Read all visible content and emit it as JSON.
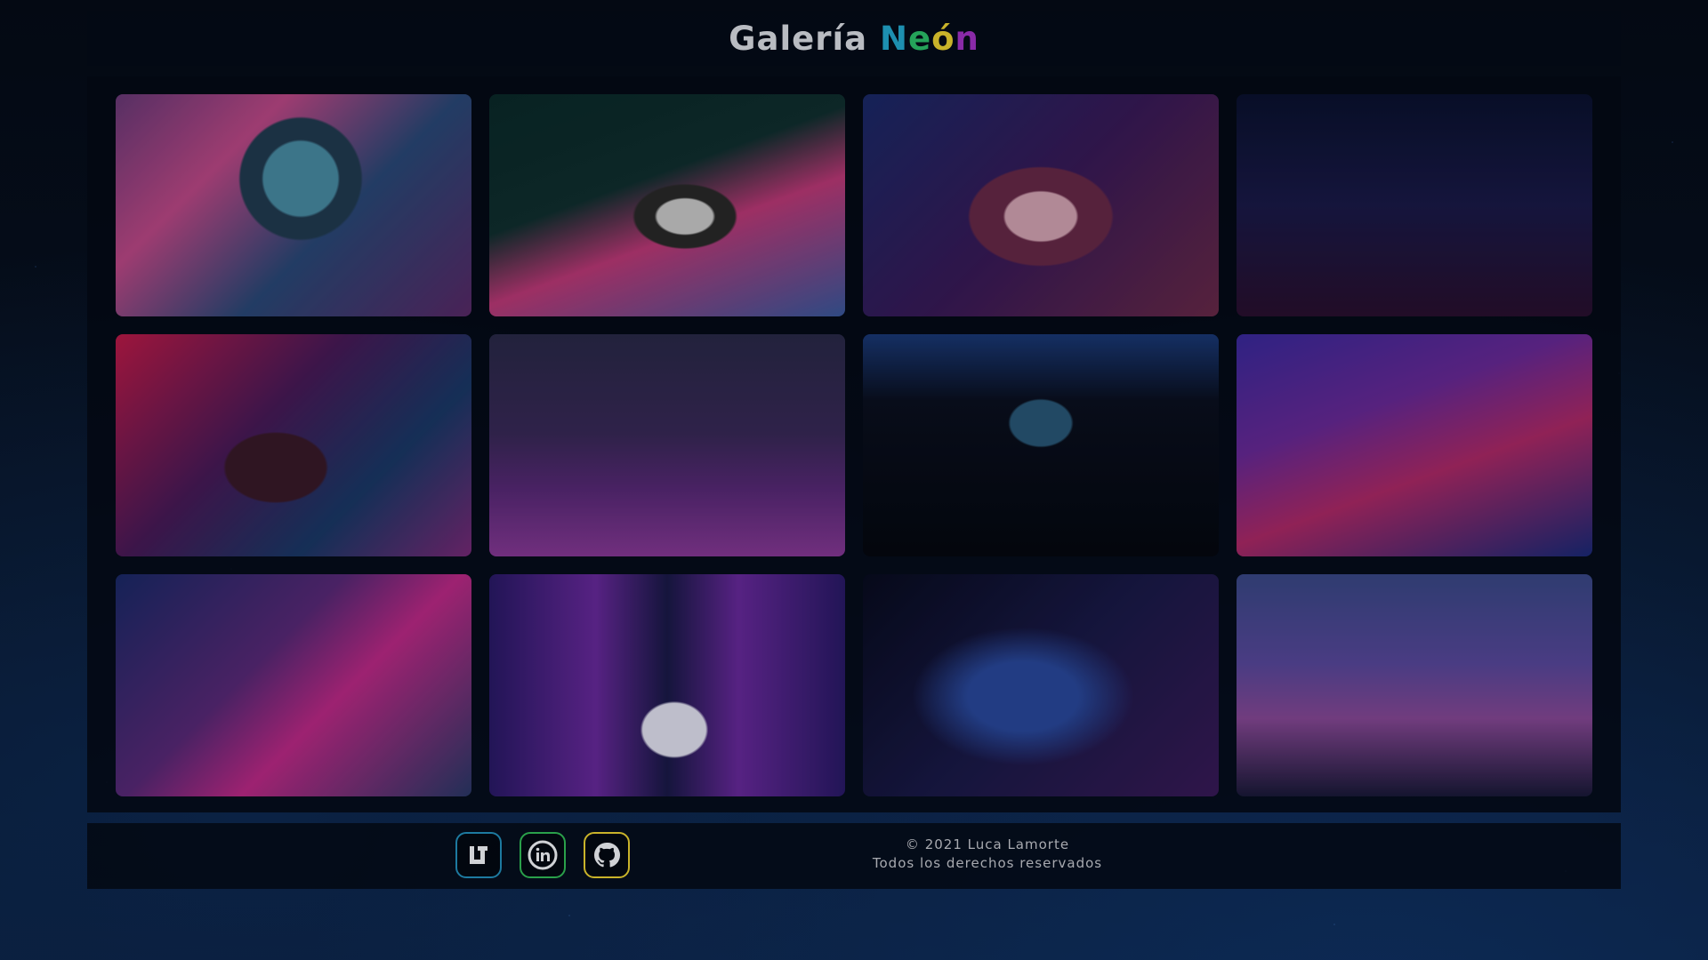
{
  "header": {
    "title_part1": "Galería ",
    "title_n": "N",
    "title_e": "e",
    "title_o": "ó",
    "title_n2": "n"
  },
  "gallery": {
    "items": [
      {
        "subject": "astronaut-helmet-neon-city"
      },
      {
        "subject": "camera-neon-sign"
      },
      {
        "subject": "girl-headphones-neon"
      },
      {
        "subject": "cyberpunk-skyline-night"
      },
      {
        "subject": "girl-all-night-long-sign"
      },
      {
        "subject": "figure-overlooking-purple-city"
      },
      {
        "subject": "arcade-room-dark"
      },
      {
        "subject": "arcade-machines-neon"
      },
      {
        "subject": "neon-city-street-wide"
      },
      {
        "subject": "arcade-corridor-door-silhouettes"
      },
      {
        "subject": "figure-floating-space-nebula"
      },
      {
        "subject": "city-skyline-light-beams"
      }
    ]
  },
  "footer": {
    "social": [
      {
        "icon": "linktree-icon",
        "color": "#1d7aa0"
      },
      {
        "icon": "linkedin-icon",
        "color": "#2aa04a"
      },
      {
        "icon": "github-icon",
        "color": "#c9b32a"
      }
    ],
    "copyright": "© 2021 Luca Lamorte",
    "rights": "Todos los derechos reservados"
  }
}
